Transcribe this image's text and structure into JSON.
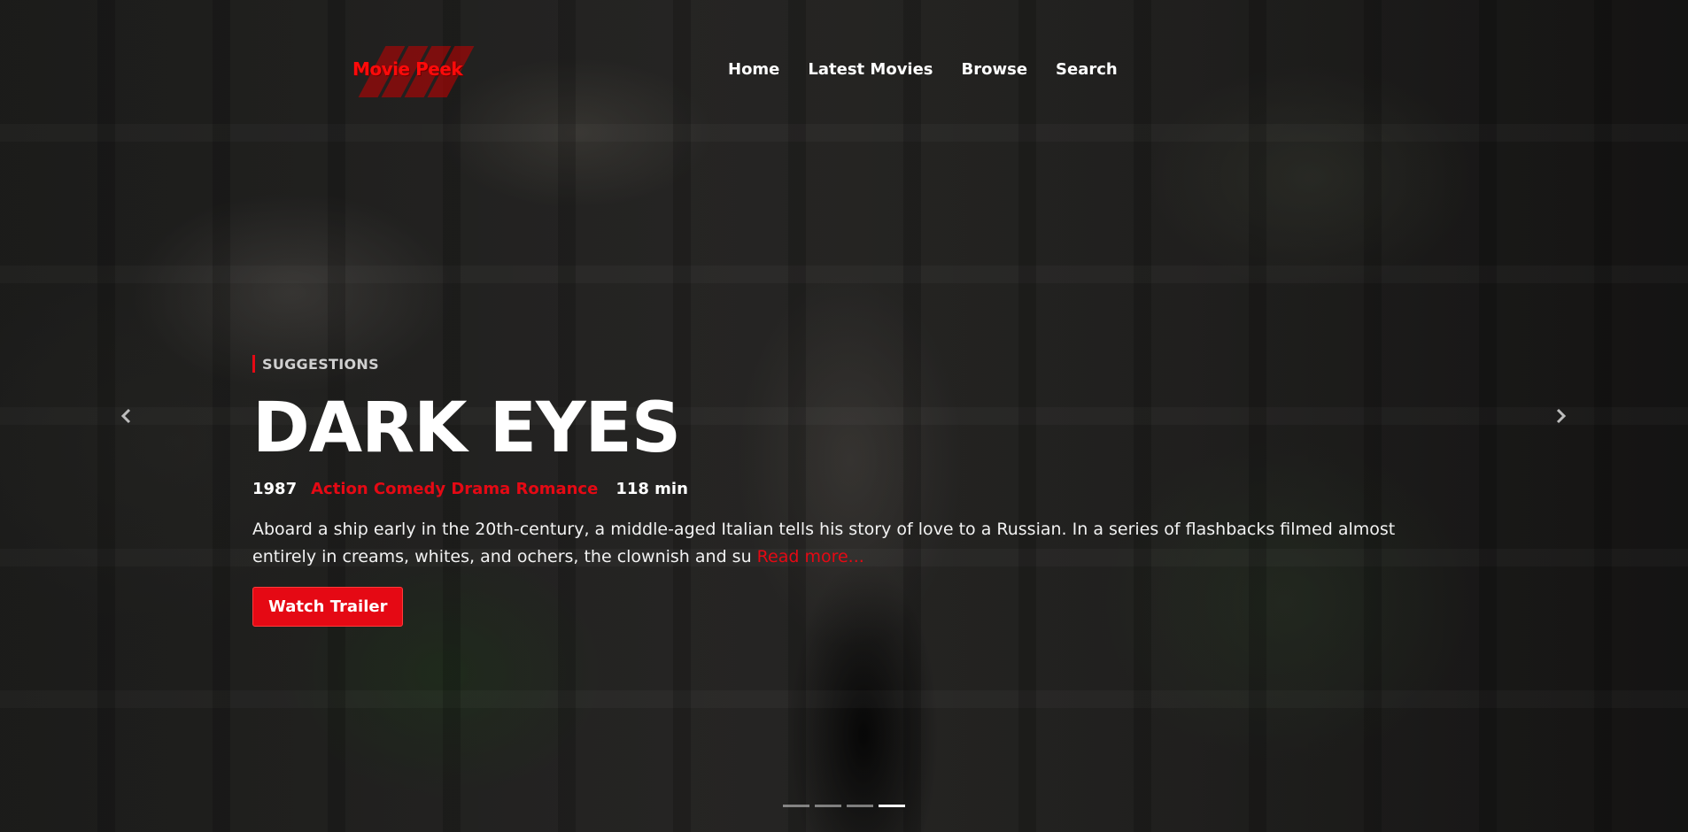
{
  "brand": {
    "name": "Movie Peek",
    "accent_color": "#e50914"
  },
  "nav": {
    "items": [
      {
        "label": "Home"
      },
      {
        "label": "Latest Movies"
      },
      {
        "label": "Browse"
      },
      {
        "label": "Search"
      }
    ]
  },
  "hero": {
    "kicker": "SUGGESTIONS",
    "title": "DARK EYES",
    "year": "1987",
    "genres": "Action Comedy Drama Romance",
    "runtime": "118 min",
    "description": "Aboard a ship early in the 20th-century, a middle-aged Italian tells his story of love to a Russian. In a series of flashbacks filmed almost entirely in creams, whites, and ochers, the clownish and su",
    "read_more": "Read more...",
    "button_label": "Watch Trailer"
  },
  "carousel": {
    "prev_icon": "chevron-left-icon",
    "next_icon": "chevron-right-icon",
    "slide_count": 4,
    "active_slide": 4
  }
}
